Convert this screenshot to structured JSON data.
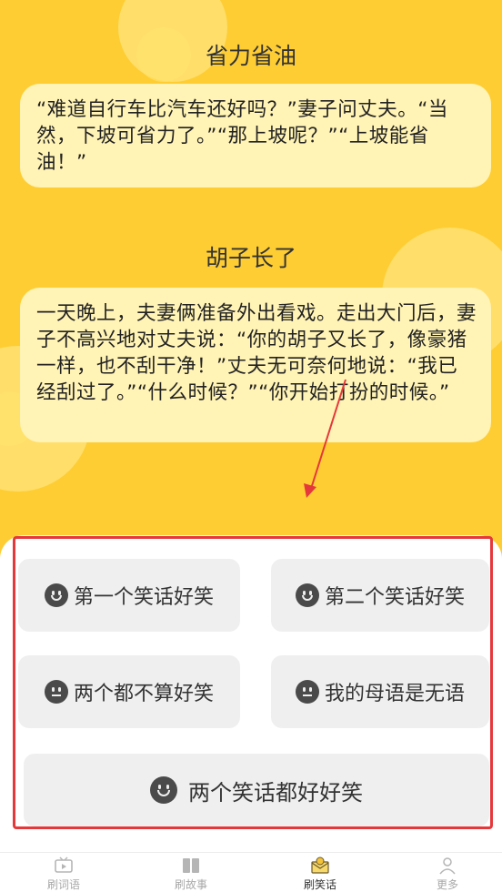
{
  "jokes": [
    {
      "title": "省力省油",
      "text": "“难道自行车比汽车还好吗？”妻子问丈夫。“当然，下坡可省力了。”“那上坡呢？”“上坡能省油！”"
    },
    {
      "title": "胡子长了",
      "text": "一天晚上，夫妻俩准备外出看戏。走出大门后，妻子不高兴地对丈夫说：“你的胡子又长了，像豪猪一样，也不刮干净！”丈夫无可奈何地说：“我已经刮过了。”“什么时候？”“你开始打扮的时候。”"
    }
  ],
  "options": {
    "first_funny": "第一个笑话好笑",
    "second_funny": "第二个笑话好笑",
    "neither_funny": "两个都不算好笑",
    "speechless": "我的母语是无语",
    "both_funny": "两个笑话都好好笑"
  },
  "tabs": [
    {
      "label": "刷词语",
      "icon": "tv-play-icon",
      "active": false
    },
    {
      "label": "刷故事",
      "icon": "book-icon",
      "active": false
    },
    {
      "label": "刷笑话",
      "icon": "laugh-envelope-icon",
      "active": true
    },
    {
      "label": "更多",
      "icon": "person-icon",
      "active": false
    }
  ],
  "colors": {
    "background_yellow": "#fecd33",
    "card_yellow": "#fff3b5",
    "highlight_red": "#e5383b",
    "option_gray": "#efefef"
  }
}
